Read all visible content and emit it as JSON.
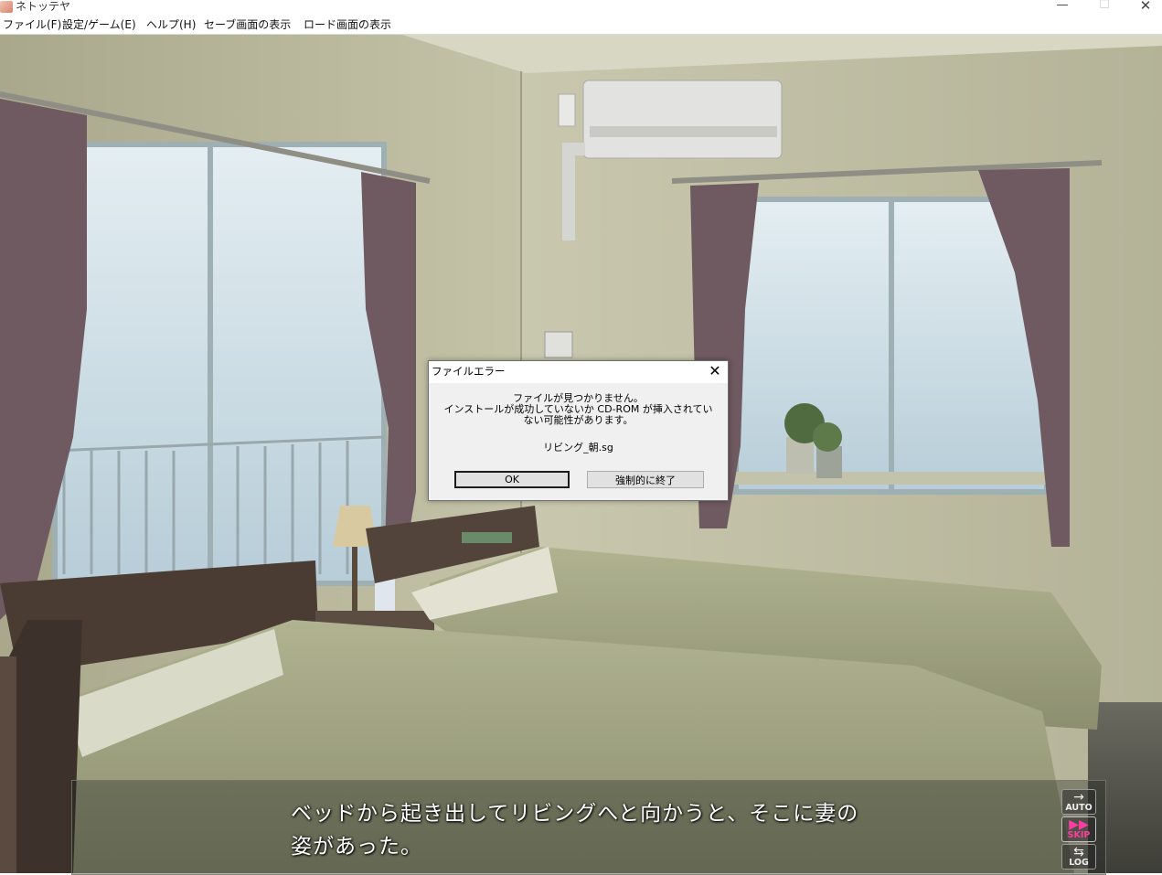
{
  "window": {
    "title": "ネトッテヤ",
    "minimize_glyph": "—",
    "maximize_glyph": "☐",
    "close_glyph": "✕"
  },
  "menu": [
    {
      "label": "ファイル(F)"
    },
    {
      "label": "設定/ゲーム(E)"
    },
    {
      "label": "ヘルプ(H)"
    },
    {
      "label": "セーブ画面の表示"
    },
    {
      "label": "ロード画面の表示"
    }
  ],
  "dialog": {
    "title": "ファイルエラー",
    "close_glyph": "✕",
    "message_lines": [
      "ファイルが見つかりません。",
      "インストールが成功していないか CD-ROM が挿入されてい",
      "ない可能性があります。"
    ],
    "filename": "リビング_朝.sg",
    "ok_label": "OK",
    "force_quit_label": "強制的に終了"
  },
  "message": {
    "line1": "ベッドから起き出してリビングへと向かうと、そこに妻の",
    "line2": "姿があった。"
  },
  "side_buttons": {
    "auto": {
      "icon": "→",
      "label": "AUTO"
    },
    "skip": {
      "icon": "▶▶",
      "label": "SKIP"
    },
    "log": {
      "icon": "⇆",
      "label": "LOG"
    }
  },
  "colors": {
    "skip_accent": "#ff3ca0",
    "wall": "#b8b79a",
    "curtain": "#6e5a60"
  }
}
